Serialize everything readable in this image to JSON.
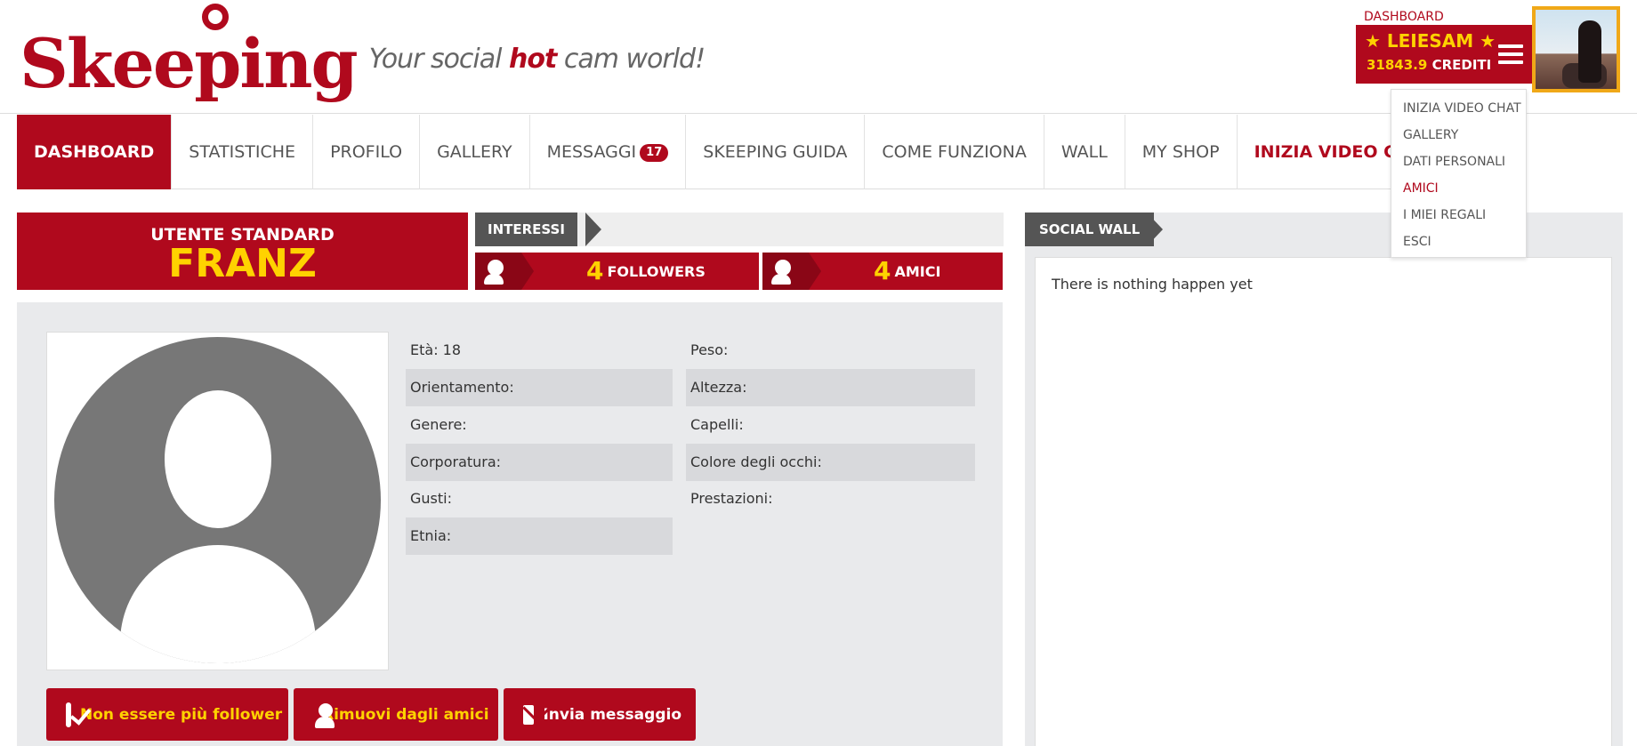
{
  "brand": {
    "name": "Skeeping",
    "tagline_part1": "Your social ",
    "tagline_hot": "hot",
    "tagline_part2": " cam world!"
  },
  "account": {
    "dashboard_link": "DASHBOARD",
    "username": "★ LEIESAM ★",
    "credits_value": "31843.9",
    "credits_label": "CREDITI"
  },
  "account_menu": {
    "items": [
      {
        "label": "INIZIA VIDEO CHAT"
      },
      {
        "label": "GALLERY"
      },
      {
        "label": "DATI PERSONALI"
      },
      {
        "label": "AMICI",
        "active": true
      },
      {
        "label": "I MIEI REGALI"
      },
      {
        "label": "ESCI"
      }
    ]
  },
  "nav": {
    "dashboard": "DASHBOARD",
    "statistiche": "STATISTICHE",
    "profilo": "PROFILO",
    "gallery": "GALLERY",
    "messaggi": "MESSAGGI",
    "messaggi_badge": "17",
    "guida": "SKEEPING GUIDA",
    "come_funziona": "COME FUNZIONA",
    "wall": "WALL",
    "shop": "MY SHOP",
    "video_chat": "INIZIA VIDEO CHAT"
  },
  "profile": {
    "user_type": "UTENTE STANDARD",
    "username": "FRANZ",
    "interests_label": "INTERESSI",
    "followers_count": "4",
    "followers_label": "FOLLOWERS",
    "friends_count": "4",
    "friends_label": "AMICI",
    "fields": {
      "eta": "Età: 18",
      "peso": "Peso:",
      "orientamento": "Orientamento:",
      "altezza": "Altezza:",
      "genere": "Genere:",
      "capelli": "Capelli:",
      "corporatura": "Corporatura:",
      "occhi": "Colore degli occhi:",
      "gusti": "Gusti:",
      "prestazioni": "Prestazioni:",
      "etnia": "Etnia:"
    },
    "actions": {
      "unfollow": "Non essere più follower",
      "remove_friend": "Rimuovi dagli amici",
      "send_message": "Invia messaggio"
    }
  },
  "wall": {
    "title": "SOCIAL WALL",
    "empty_text": "There is nothing happen yet"
  },
  "colors": {
    "brand_red": "#b0091d",
    "accent_yellow": "#ffd200",
    "panel_gray": "#e9eaec"
  }
}
